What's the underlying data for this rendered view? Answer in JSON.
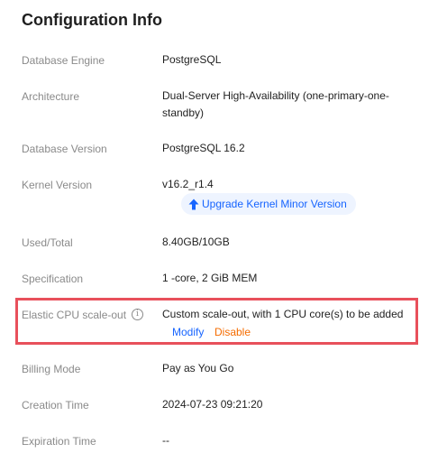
{
  "section": {
    "title": "Configuration Info"
  },
  "fields": {
    "engine": {
      "label": "Database Engine",
      "value": "PostgreSQL"
    },
    "architecture": {
      "label": "Architecture",
      "value_line1": "Dual-Server High-Availability (one-primary-one-",
      "value_line2": "standby)"
    },
    "db_version": {
      "label": "Database Version",
      "value": "PostgreSQL 16.2"
    },
    "kernel": {
      "label": "Kernel Version",
      "value": "v16.2_r1.4",
      "upgrade_label": "Upgrade Kernel Minor Version"
    },
    "used_total": {
      "label": "Used/Total",
      "value": "8.40GB/10GB"
    },
    "spec": {
      "label": "Specification",
      "value": "1 -core, 2 GiB MEM"
    },
    "elastic_cpu": {
      "label": "Elastic CPU scale-out",
      "value": "Custom scale-out, with 1 CPU core(s) to be added",
      "modify_label": "Modify",
      "disable_label": "Disable"
    },
    "billing": {
      "label": "Billing Mode",
      "value": "Pay as You Go"
    },
    "creation": {
      "label": "Creation Time",
      "value": "2024-07-23 09:21:20"
    },
    "expiration": {
      "label": "Expiration Time",
      "value": "--"
    }
  },
  "colors": {
    "link": "#1664ff",
    "warning": "#f56c00",
    "highlight": "#e8505b",
    "label": "#8a8a8a"
  },
  "icons": {
    "upgrade": "arrow-up-icon",
    "info": "info-circle-icon"
  }
}
